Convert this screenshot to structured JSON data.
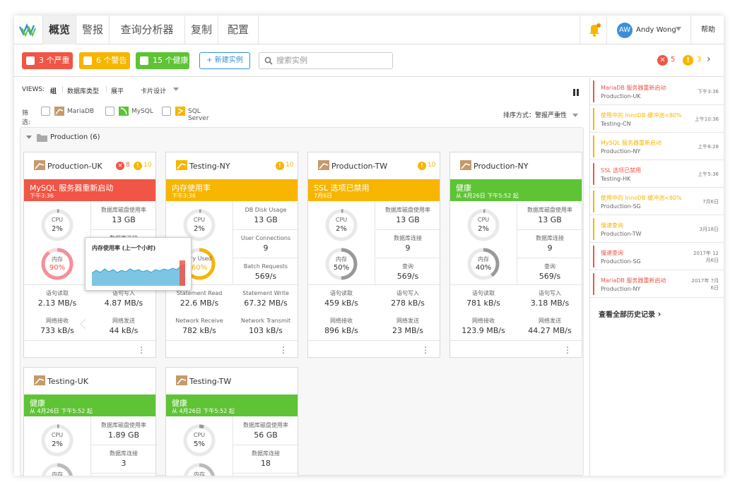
{
  "nav": {
    "tabs": [
      "概览",
      "警报",
      "查询分析器",
      "复制",
      "配置"
    ],
    "user_initials": "AW",
    "user_name": "Andy Wong",
    "help": "帮助"
  },
  "toolbar": {
    "filters": [
      {
        "label": "3 个严重",
        "color": "#f05545"
      },
      {
        "label": "6 个警告",
        "color": "#f7b500"
      },
      {
        "label": "15 个健康",
        "color": "#5ec335"
      }
    ],
    "new_instance": "+ 新建实例",
    "search_placeholder": "搜索实例",
    "critical_count": "5",
    "warning_count": "3"
  },
  "views": {
    "label": "VIEWS:",
    "options": [
      "组",
      "数据库类型",
      "展平"
    ],
    "layout": "卡片设计"
  },
  "filter_row": {
    "label": "筛选:",
    "types": [
      "MariaDB",
      "MySQL",
      "SQL Server"
    ],
    "sort": "排序方式：警报严重性"
  },
  "group": {
    "name": "Production (6)"
  },
  "cards": [
    {
      "name": "Production-UK",
      "crit": "8",
      "warn": "10",
      "banner": "MySQL 服务器重新启动",
      "banner_sub": "下午3:36",
      "banner_color": "#f05545",
      "cpu": "2%",
      "mem": "90%",
      "m1l": "数据库磁盘使用率",
      "m1v": "13 GB",
      "m2l": "数据库连接",
      "m2v": "",
      "m3l": "",
      "m3v": "",
      "r1al": "语句读取",
      "r1av": "2.13 MB/s",
      "r1bl": "语句写入",
      "r1bv": "4.87 MB/s",
      "r2al": "网络接收",
      "r2av": "733 kB/s",
      "r2bl": "网络发送",
      "r2bv": "44 kB/s"
    },
    {
      "name": "Testing-NY",
      "crit": "",
      "warn": "10",
      "banner": "内存使用率",
      "banner_sub": "下午3:36",
      "banner_color": "#f7b500",
      "cpu": "2%",
      "mem": "60%",
      "mem_label": "ory Used",
      "m1l": "DB Disk Usage",
      "m1v": "13 GB",
      "m2l": "User Connections",
      "m2v": "9",
      "m3l": "Batch Requests",
      "m3v": "569/s",
      "r1al": "Statement Read",
      "r1av": "22.6 MB/s",
      "r1bl": "Statement Write",
      "r1bv": "67.32 MB/s",
      "r2al": "Network Receive",
      "r2av": "782 kB/s",
      "r2bl": "Network Transmit",
      "r2bv": "103 kB/s"
    },
    {
      "name": "Production-TW",
      "crit": "",
      "warn": "10",
      "banner": "SSL 选项已禁用",
      "banner_sub": "7月6日",
      "banner_color": "#f7b500",
      "cpu": "2%",
      "mem": "50%",
      "m1l": "数据库磁盘使用率",
      "m1v": "13 GB",
      "m2l": "数据库连接",
      "m2v": "9",
      "m3l": "查询",
      "m3v": "569/s",
      "r1al": "语句读取",
      "r1av": "459 kB/s",
      "r1bl": "语句写入",
      "r1bv": "278 kB/s",
      "r2al": "网络接收",
      "r2av": "896 kB/s",
      "r2bl": "网络发送",
      "r2bv": "23 MB/s"
    },
    {
      "name": "Production-NY",
      "crit": "",
      "warn": "",
      "banner": "健康",
      "banner_sub": "从 4月26日 下午5:52 起",
      "banner_color": "#5ec335",
      "cpu": "2%",
      "mem": "40%",
      "m1l": "数据库磁盘使用率",
      "m1v": "13 GB",
      "m2l": "数据库连接",
      "m2v": "9",
      "m3l": "查询",
      "m3v": "569/s",
      "r1al": "语句读取",
      "r1av": "781 kB/s",
      "r1bl": "语句写入",
      "r1bv": "3.18 MB/s",
      "r2al": "网络接收",
      "r2av": "123.9 MB/s",
      "r2bl": "网络发送",
      "r2bv": "44.27 MB/s"
    },
    {
      "name": "Testing-UK",
      "crit": "",
      "warn": "",
      "banner": "健康",
      "banner_sub": "从 4月26日 下午5:52 起",
      "banner_color": "#5ec335",
      "cpu": "2%",
      "mem": "",
      "m1l": "数据库磁盘使用率",
      "m1v": "1.89 GB",
      "m2l": "数据库连接",
      "m2v": "3"
    },
    {
      "name": "Testing-TW",
      "crit": "",
      "warn": "",
      "banner": "健康",
      "banner_sub": "从 4月26日 下午5:52 起",
      "banner_color": "#5ec335",
      "cpu": "5%",
      "mem": "",
      "m1l": "数据库磁盘使用率",
      "m1v": "56 GB",
      "m2l": "数据库连接",
      "m2v": "18"
    }
  ],
  "labels": {
    "cpu": "CPU",
    "mem": "内存"
  },
  "tooltip": {
    "title": "内存使用率 (上一个小时)"
  },
  "alerts": [
    {
      "title": "MariaDB 服务器重新启动",
      "instance": "Production-UK",
      "time": "下午3:36",
      "level": "critical"
    },
    {
      "title": "使用中的 InnoDB 缓冲池<80%",
      "instance": "Testing-CN",
      "time": "上午10:36",
      "level": "warning"
    },
    {
      "title": "MySQL 服务器重新启动",
      "instance": "Production-NY",
      "time": "上午8:28",
      "level": "warning"
    },
    {
      "title": "SSL 选项已禁用",
      "instance": "Testing-HK",
      "time": "上午5:36",
      "level": "critical"
    },
    {
      "title": "使用中的 InnoDB 缓冲池<80%",
      "instance": "Production-SG",
      "time": "7月6日",
      "level": "warning"
    },
    {
      "title": "慢速查询",
      "instance": "Production-TW",
      "time": "3月18日",
      "level": "warning"
    },
    {
      "title": "慢速查询",
      "instance": "Production-SG",
      "time": "2017年 12月6日",
      "level": "critical"
    },
    {
      "title": "MariaDB 服务器重新启动",
      "instance": "Production-NY",
      "time": "2017年 7月6日",
      "level": "critical"
    }
  ],
  "view_all": "查看全部历史记录",
  "colors": {
    "critical": "#f05545",
    "warning": "#f7b500",
    "healthy": "#5ec335",
    "accent": "#3a8fd6"
  }
}
